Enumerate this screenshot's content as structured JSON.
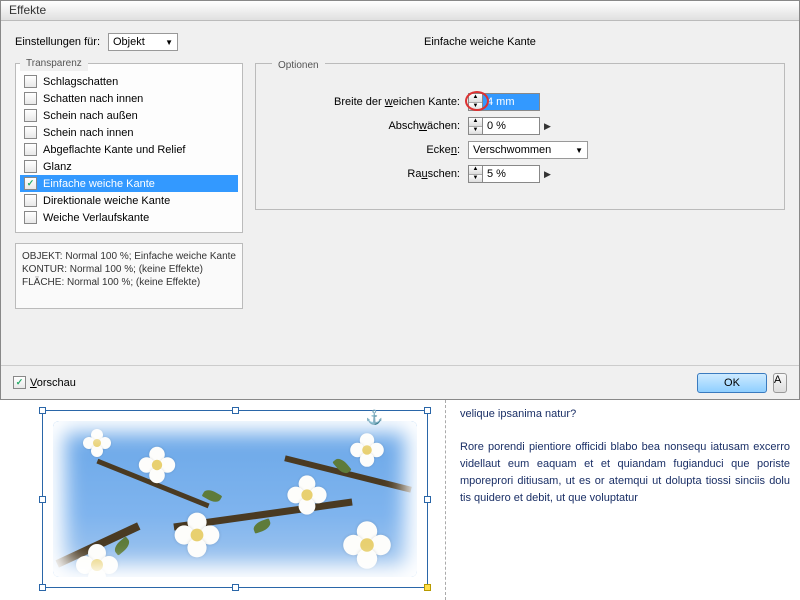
{
  "dialog": {
    "title": "Effekte",
    "settings_label": "Einstellungen für:",
    "settings_value": "Objekt",
    "panel_title": "Einfache weiche Kante",
    "transparency_group": "Transparenz",
    "effects": [
      {
        "label": "Schlagschatten",
        "checked": false,
        "selected": false
      },
      {
        "label": "Schatten nach innen",
        "checked": false,
        "selected": false
      },
      {
        "label": "Schein nach außen",
        "checked": false,
        "selected": false
      },
      {
        "label": "Schein nach innen",
        "checked": false,
        "selected": false
      },
      {
        "label": "Abgeflachte Kante und Relief",
        "checked": false,
        "selected": false
      },
      {
        "label": "Glanz",
        "checked": false,
        "selected": false
      },
      {
        "label": "Einfache weiche Kante",
        "checked": true,
        "selected": true
      },
      {
        "label": "Direktionale weiche Kante",
        "checked": false,
        "selected": false
      },
      {
        "label": "Weiche Verlaufskante",
        "checked": false,
        "selected": false
      }
    ],
    "status_text": "OBJEKT: Normal 100 %; Einfache weiche Kante\nKONTUR: Normal 100 %; (keine Effekte)\nFLÄCHE: Normal 100 %; (keine Effekte)",
    "options_label": "Optionen",
    "options": {
      "width_label_pre": "Breite der ",
      "width_label_u": "w",
      "width_label_post": "eichen Kante:",
      "width_value": "4 mm",
      "atten_label_pre": "Absch",
      "atten_label_u": "w",
      "atten_label_post": "ächen:",
      "atten_value": "0 %",
      "corners_label_pre": "Ecke",
      "corners_label_u": "n",
      "corners_label_post": ":",
      "corners_value": "Verschwommen",
      "noise_label_pre": "Ra",
      "noise_label_u": "u",
      "noise_label_post": "schen:",
      "noise_value": "5 %"
    },
    "preview_label": "Vorschau",
    "preview_u": "V",
    "preview_post": "orschau",
    "ok_label": "OK",
    "other_label": "A"
  },
  "document": {
    "heading": "velique ipsanima natur?",
    "body": "Rore porendi pientiore officidi blabo bea nonsequ iatusam excerro videllaut eum eaquam et et quiandam fugianduci que poriste mporeprori ditiusam, ut es or atemqui ut dolupta tiossi sinciis dolu tis quidero et debit, ut que voluptatur"
  }
}
